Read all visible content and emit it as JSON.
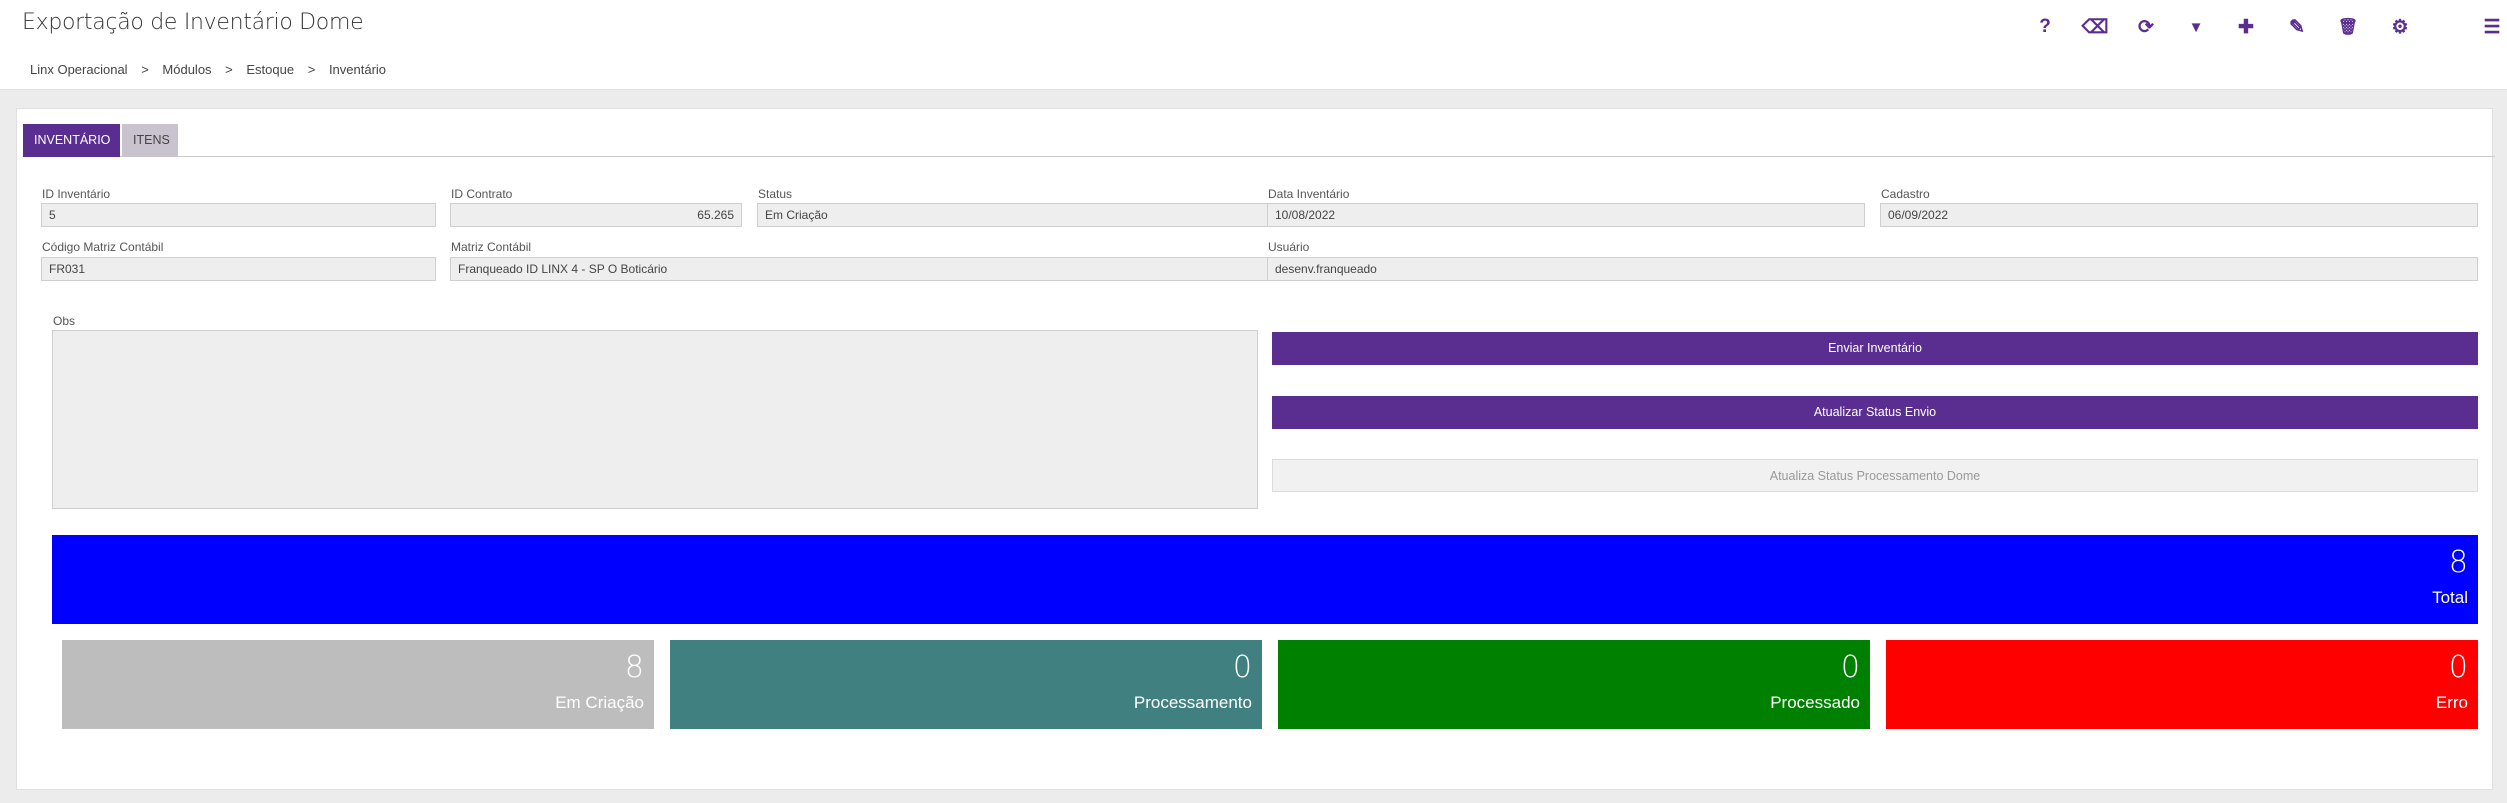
{
  "header": {
    "title": "Exportação de Inventário Dome",
    "toolbar": [
      {
        "name": "help-icon",
        "glyph": "?"
      },
      {
        "name": "eraser-icon",
        "glyph": "⌫"
      },
      {
        "name": "refresh-icon",
        "glyph": "⟳"
      },
      {
        "name": "filter-icon",
        "glyph": "▼"
      },
      {
        "name": "add-icon",
        "glyph": "✚"
      },
      {
        "name": "edit-icon",
        "glyph": "✎"
      },
      {
        "name": "trash-icon",
        "glyph": "🗑"
      },
      {
        "name": "gear-icon",
        "glyph": "⚙"
      },
      {
        "name": "menu-icon",
        "glyph": "☰"
      }
    ]
  },
  "breadcrumb": {
    "items": [
      "Linx Operacional",
      "Módulos",
      "Estoque",
      "Inventário"
    ],
    "separator": ">"
  },
  "tabs": {
    "active": "INVENTÁRIO",
    "inactive": "ITENS"
  },
  "form": {
    "id_inventario": {
      "label": "ID Inventário",
      "value": "5"
    },
    "id_contrato": {
      "label": "ID Contrato",
      "value": "65.265"
    },
    "status": {
      "label": "Status",
      "value": "Em Criação"
    },
    "data_inventario": {
      "label": "Data Inventário",
      "value": "10/08/2022"
    },
    "cadastro": {
      "label": "Cadastro",
      "value": "06/09/2022"
    },
    "codigo_matriz": {
      "label": "Código Matriz Contábil",
      "value": "FR031"
    },
    "matriz_contabil": {
      "label": "Matriz Contábil",
      "value": "Franqueado ID LINX 4 - SP O Boticário"
    },
    "usuario": {
      "label": "Usuário",
      "value": "desenv.franqueado"
    },
    "obs": {
      "label": "Obs",
      "value": ""
    }
  },
  "actions": {
    "enviar": "Enviar Inventário",
    "atualizar_envio": "Atualizar Status Envio",
    "atualiza_processamento": "Atualiza Status Processamento Dome"
  },
  "summary": {
    "total": {
      "value": "8",
      "label": "Total",
      "color": "#0000ff"
    },
    "cards": [
      {
        "value": "8",
        "label": "Em Criação",
        "color": "#bdbdbd"
      },
      {
        "value": "0",
        "label": "Processamento",
        "color": "#418080"
      },
      {
        "value": "0",
        "label": "Processado",
        "color": "#008000"
      },
      {
        "value": "0",
        "label": "Erro",
        "color": "#ff0000"
      }
    ]
  },
  "colors": {
    "accent": "#5a2d91"
  }
}
